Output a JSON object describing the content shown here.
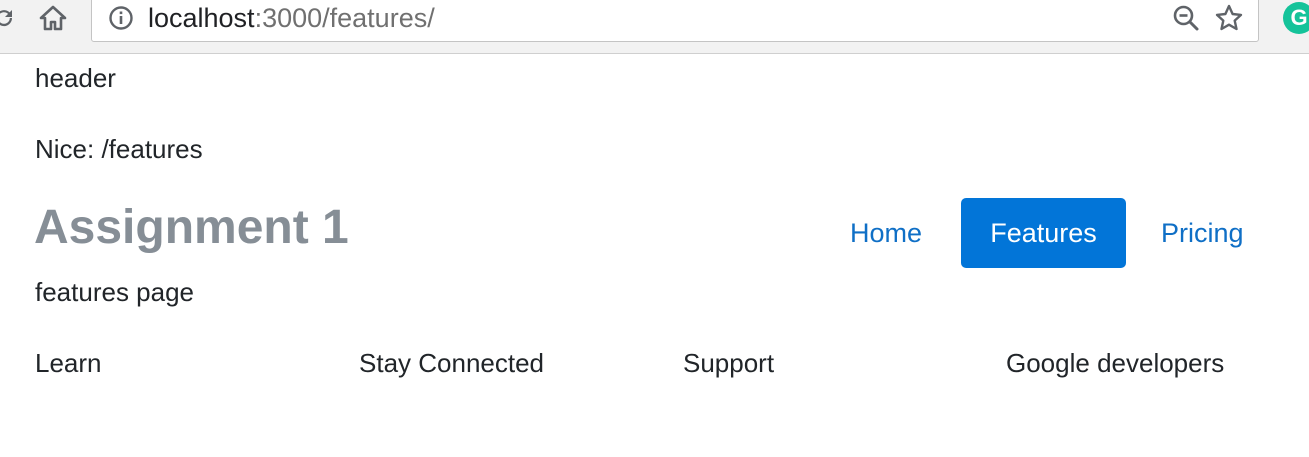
{
  "browser": {
    "url_host": "localhost",
    "url_path": ":3000/features/",
    "extension_letter": "G",
    "extension_color": "#15c39a",
    "icons": [
      "reload-icon",
      "home-icon",
      "info-icon",
      "zoom-out-icon",
      "star-icon",
      "grammarly-icon"
    ]
  },
  "page": {
    "header_text": "header",
    "route_text": "Nice: /features",
    "title": "Assignment 1",
    "description": "features page",
    "accent_color": "#0275d8"
  },
  "nav": {
    "items": [
      {
        "label": "Home",
        "active": false
      },
      {
        "label": "Features",
        "active": true
      },
      {
        "label": "Pricing",
        "active": false
      }
    ]
  },
  "footer": {
    "columns": [
      "Learn",
      "Stay Connected",
      "Support",
      "Google developers"
    ]
  }
}
